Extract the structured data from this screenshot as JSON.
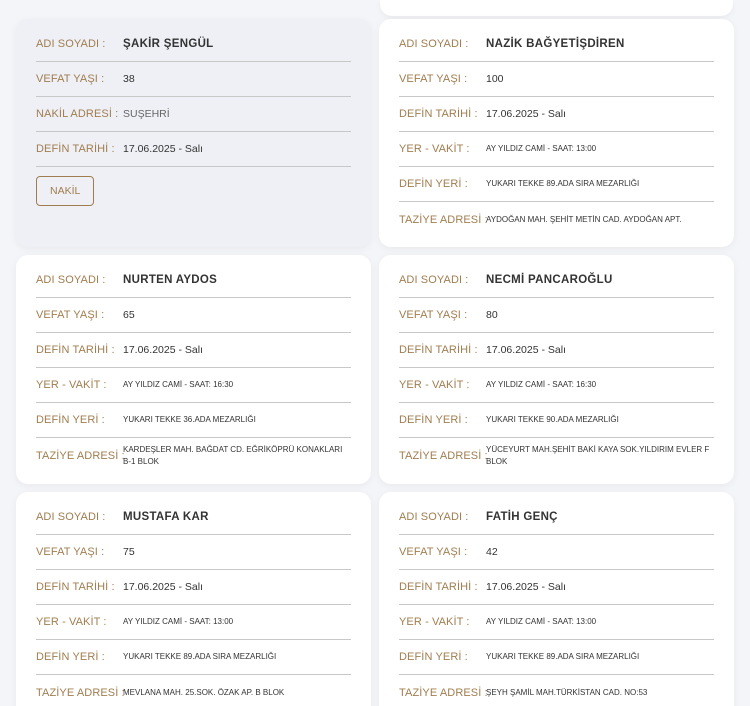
{
  "labels": {
    "name": "ADI SOYADI :",
    "age": "VEFAT YAŞI :",
    "transfer": "NAKİL ADRESİ :",
    "burial_date": "DEFİN TARİHİ :",
    "place_time": "YER - VAKİT :",
    "burial_place": "DEFİN YERİ :",
    "condolence": "TAZİYE ADRESİ :"
  },
  "cards": [
    {
      "name": "ŞAKİR ŞENGÜL",
      "age": "38",
      "transfer": "SUŞEHRİ",
      "burial_date": "17.06.2025 - Salı",
      "button": "NAKİL"
    },
    {
      "name": "NAZİK BAĞYETİŞDİREN",
      "age": "100",
      "burial_date": "17.06.2025 - Salı",
      "place_time": "AY YILDIZ CAMİ - SAAT: 13:00",
      "burial_place": "YUKARI TEKKE 89.ADA SIRA MEZARLIĞI",
      "condolence": "AYDOĞAN MAH. ŞEHİT METİN CAD. AYDOĞAN APT."
    },
    {
      "name": "NURTEN AYDOS",
      "age": "65",
      "burial_date": "17.06.2025 - Salı",
      "place_time": "AY YILDIZ CAMİ - SAAT: 16:30",
      "burial_place": "YUKARI TEKKE 36.ADA MEZARLIĞI",
      "condolence": "KARDEŞLER MAH. BAĞDAT CD. EĞRİKÖPRÜ KONAKLARI B-1 BLOK"
    },
    {
      "name": "NECMİ PANCAROĞLU",
      "age": "80",
      "burial_date": "17.06.2025 - Salı",
      "place_time": "AY YILDIZ CAMİ - SAAT: 16:30",
      "burial_place": "YUKARI TEKKE 90.ADA MEZARLIĞI",
      "condolence": "YÜCEYURT MAH.ŞEHİT BAKİ KAYA SOK.YILDIRIM EVLER F BLOK"
    },
    {
      "name": "MUSTAFA KAR",
      "age": "75",
      "burial_date": "17.06.2025 - Salı",
      "place_time": "AY YILDIZ CAMİ - SAAT: 13:00",
      "burial_place": "YUKARI TEKKE 89.ADA SIRA MEZARLIĞI",
      "condolence": "MEVLANA MAH. 25.SOK. ÖZAK AP. B BLOK"
    },
    {
      "name": "FATİH GENÇ",
      "age": "42",
      "burial_date": "17.06.2025 - Salı",
      "place_time": "AY YILDIZ CAMİ - SAAT: 13:00",
      "burial_place": "YUKARI TEKKE 89.ADA SIRA MEZARLIĞI",
      "condolence": "ŞEYH ŞAMİL MAH.TÜRKİSTAN CAD. NO:53"
    }
  ],
  "colors": {
    "label": "#a07d4f",
    "value": "#333333",
    "active_card": "#eef0f5",
    "page_bg": "#f4f5f9"
  }
}
